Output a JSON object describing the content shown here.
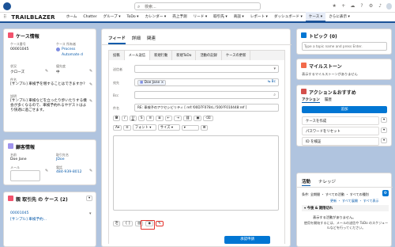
{
  "topbar": {
    "search_placeholder": "検索...",
    "search_icon": "search-icon"
  },
  "nav": {
    "app_name": "TRAILBLAZER",
    "items": [
      "ホーム",
      "Chatter",
      "グループ ▾",
      "ToDo ▾",
      "カレンダー ▾",
      "売上予測",
      "リード ▾",
      "取引先 ▾",
      "商談 ▾",
      "レポート ▾",
      "ダッシュボード ▾",
      "ケース ▾",
      "さらに表示 ▾"
    ]
  },
  "case_info": {
    "title": "ケース情報",
    "case_number_label": "ケース番号",
    "case_number": "00001045",
    "owner_label": "ケース 所有者",
    "owner": "Process Automate d",
    "status_label": "状況",
    "status": "クローズ",
    "priority_label": "優先度",
    "priority": "中",
    "subject_label": "件名",
    "subject": "[サンプル] 車検予を増することはできますか?",
    "description_label": "説明",
    "description": "[サンプル] 車検などを立ったり歩いたりする機会が多くなるので、車検予約れるやゲストはより快適に過ごせます。"
  },
  "customer_info": {
    "title": "顧客情報",
    "name_label": "名前",
    "name": "Doe Jane",
    "contact_label": "取引先名",
    "contact": "JDoe",
    "email_label": "メール",
    "phone_label": "電話",
    "phone": "484-939-8012"
  },
  "related_cases": {
    "title": "親 取引先 の ケース (2)",
    "case1_number": "00001045",
    "case1_subject": "[サンプル] 車検予約..."
  },
  "center": {
    "tabs": [
      "フィード",
      "詳細",
      "関連"
    ],
    "subtabs": [
      "投稿",
      "メール送信",
      "新規行動",
      "新規ToDo",
      "活動の記録",
      "ケースの更新"
    ],
    "from_label": "送信者",
    "to_label": "宛先",
    "to_value": "Doe Jane",
    "cc_label": "Bcc",
    "subject_label": "件名",
    "subject_value": "RE: 車検予のアクセシビリティ [ ref:!00D7F078rL.!500?F010448:ref ]",
    "font_label": "フォント",
    "size_label": "サイズ",
    "send_button": "承認申請"
  },
  "right": {
    "topics_title": "トピック (0)",
    "topics_placeholder": "Type a topic name and press Enter.",
    "milestone_title": "マイルストーン",
    "milestone_text": "表示するマイルストーンがありません",
    "actions_title": "アクション＆おすすめ",
    "actions_tabs": [
      "アクション",
      "履歴"
    ],
    "add_button": "追加",
    "action_items": [
      "ケースを作成",
      "パスワードをリセット",
      "ID を検証"
    ],
    "activity_tabs": [
      "活動",
      "ナレッジ"
    ],
    "filter_text": "条件: 全期間 ・ すべての活動 ・ すべての種別",
    "links_text": "更新 ・ すべて展開 ・ すべて表示",
    "upcoming_label": "今後 & 期限切れ",
    "no_activity": "表示する活動がありません。",
    "no_activity_sub": "使用を開始するには、メールの送信や ToDo のスケジュールなどを行ってください。"
  }
}
